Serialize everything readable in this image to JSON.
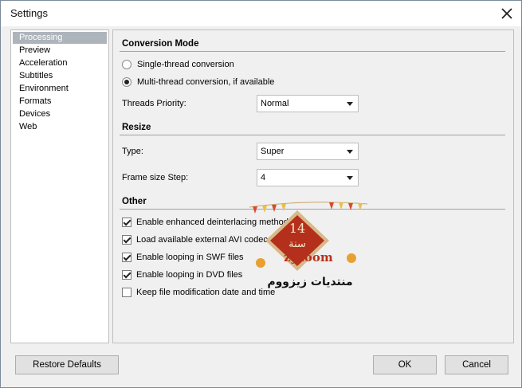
{
  "window": {
    "title": "Settings"
  },
  "sidebar": {
    "items": [
      {
        "label": "Processing",
        "selected": true
      },
      {
        "label": "Preview",
        "selected": false
      },
      {
        "label": "Acceleration",
        "selected": false
      },
      {
        "label": "Subtitles",
        "selected": false
      },
      {
        "label": "Environment",
        "selected": false
      },
      {
        "label": "Formats",
        "selected": false
      },
      {
        "label": "Devices",
        "selected": false
      },
      {
        "label": "Web",
        "selected": false
      }
    ]
  },
  "conversion_mode": {
    "title": "Conversion Mode",
    "options": [
      {
        "label": "Single-thread conversion",
        "checked": false
      },
      {
        "label": "Multi-thread conversion, if available",
        "checked": true
      }
    ],
    "threads_priority": {
      "label": "Threads Priority:",
      "value": "Normal"
    }
  },
  "resize": {
    "title": "Resize",
    "type": {
      "label": "Type:",
      "value": "Super"
    },
    "frame_step": {
      "label": "Frame size Step:",
      "value": "4"
    }
  },
  "other": {
    "title": "Other",
    "options": [
      {
        "label": "Enable enhanced deinterlacing method",
        "checked": true
      },
      {
        "label": "Load available external AVI codecs",
        "checked": true
      },
      {
        "label": "Enable looping in SWF files",
        "checked": true
      },
      {
        "label": "Enable looping in DVD files",
        "checked": true
      },
      {
        "label": "Keep file modification date and time",
        "checked": false
      }
    ]
  },
  "footer": {
    "restore_label": "Restore Defaults",
    "ok_label": "OK",
    "cancel_label": "Cancel"
  },
  "watermark": {
    "badge_number": "14",
    "badge_text": "سنة",
    "brand": "zyzoom",
    "tagline": "منتديات زيزووم"
  },
  "colors": {
    "selection": "#aeb4bb",
    "watermark_red": "#b5301c",
    "watermark_tan": "#d8b98a"
  }
}
